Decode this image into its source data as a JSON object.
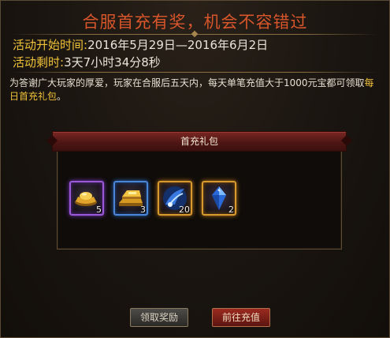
{
  "event": {
    "title": "合服首充有奖，机会不容错过",
    "start_label": "活动开始时间:",
    "start_value": "2016年5月29日—2016年6月2日",
    "remain_label": "活动剩时:",
    "remain_value": "3天7小时34分8秒",
    "desc_main": "为答谢广大玩家的厚爱，玩家在合服后五天内，每天单笔充值大于1000元宝都可领取",
    "desc_highlight": "每日首充礼包",
    "desc_end": "。"
  },
  "gift_pack": {
    "title": "首充礼包",
    "items": [
      {
        "icon": "gold-ingot-icon",
        "count": "5",
        "rarity_color": "#9b59d9"
      },
      {
        "icon": "gold-bars-icon",
        "count": "3",
        "rarity_color": "#4a86d8"
      },
      {
        "icon": "blue-energy-icon",
        "count": "20",
        "rarity_color": "#d89a2e"
      },
      {
        "icon": "blue-crystal-icon",
        "count": "2",
        "rarity_color": "#d89a2e"
      }
    ]
  },
  "buttons": {
    "claim": "领取奖励",
    "recharge": "前往充值"
  },
  "colors": {
    "title": "#d6552a",
    "label": "#f0c23a",
    "text": "#e9e4d8",
    "header_red": "#4f1614"
  }
}
